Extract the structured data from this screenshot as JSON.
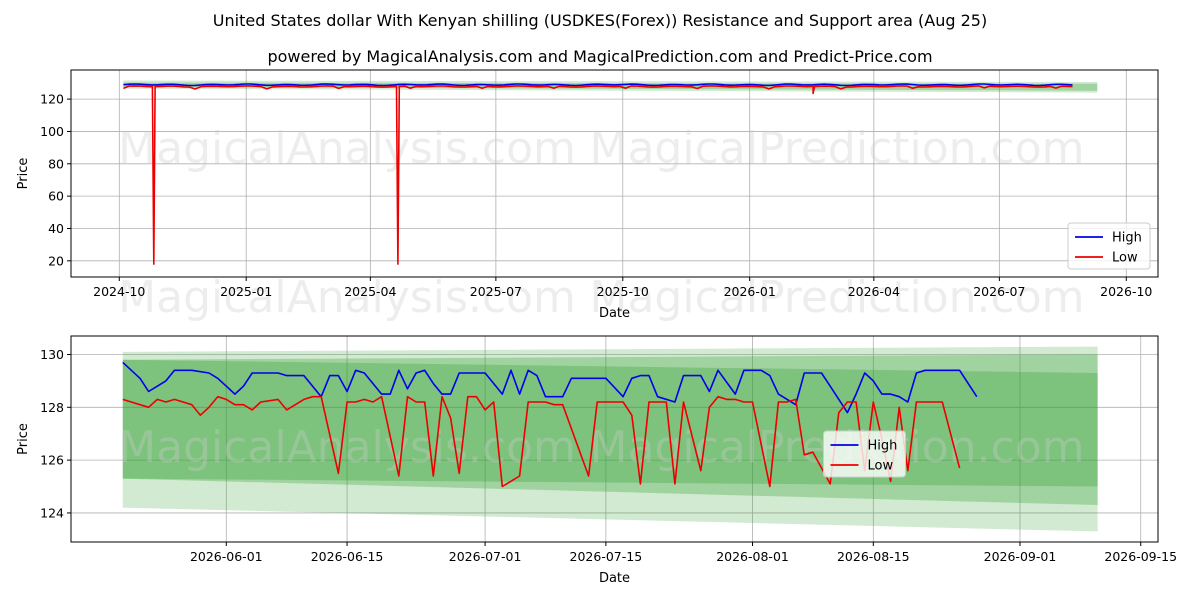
{
  "title": "United States dollar With Kenyan shilling (USDKES(Forex)) Resistance and Support area (Aug 25)",
  "subtitle": "powered by MagicalAnalysis.com and MagicalPrediction.com and Predict-Price.com",
  "watermarks": [
    "MagicalAnalysis.com",
    "MagicalPrediction.com"
  ],
  "colors": {
    "high": "#0000ee",
    "low": "#ee0000",
    "band": "#2e9e2e"
  },
  "chart_data": [
    {
      "type": "line",
      "xlabel": "Date",
      "ylabel": "Price",
      "xlim": [
        "2024-08-27",
        "2026-10-24"
      ],
      "ylim": [
        10,
        138
      ],
      "x_ticks": [
        "2024-10",
        "2025-01",
        "2025-04",
        "2025-07",
        "2025-10",
        "2026-01",
        "2026-04",
        "2026-07",
        "2026-10"
      ],
      "y_ticks": [
        20,
        40,
        60,
        80,
        100,
        120
      ],
      "grid": true,
      "legend": "lower-right",
      "series_start": "2024-10-04",
      "series_end": "2026-08-25",
      "series_defaults": {
        "high": 128.9,
        "low": 127.8
      },
      "low_spikes": [
        {
          "x": "2024-10-26",
          "low": 18
        },
        {
          "x": "2025-04-21",
          "low": 18
        },
        {
          "x": "2026-02-16",
          "low": 123.5
        }
      ],
      "bands": [
        {
          "x": [
            "2024-10-04",
            "2026-09-10"
          ],
          "upper": [
            131.5,
            130.6
          ],
          "lower": [
            126.5,
            124.0
          ]
        },
        {
          "x": [
            "2024-10-04",
            "2026-09-10"
          ],
          "upper": [
            130.2,
            129.5
          ],
          "lower": [
            127.6,
            125.2
          ]
        }
      ],
      "series": [
        {
          "name": "High",
          "color": "#0000ee"
        },
        {
          "name": "Low",
          "color": "#ee0000"
        }
      ]
    },
    {
      "type": "line",
      "xlabel": "Date",
      "ylabel": "Price",
      "xlim": [
        "2026-05-14",
        "2026-09-17"
      ],
      "ylim": [
        122.9,
        130.7
      ],
      "x_ticks": [
        "2026-06-01",
        "2026-06-15",
        "2026-07-01",
        "2026-07-15",
        "2026-08-01",
        "2026-08-15",
        "2026-09-01",
        "2026-09-15"
      ],
      "y_ticks": [
        124,
        126,
        128,
        130
      ],
      "grid": true,
      "legend": "center",
      "bands": [
        {
          "x": [
            "2026-05-20",
            "2026-09-10"
          ],
          "upper": [
            130.1,
            130.3
          ],
          "lower": [
            124.2,
            123.3
          ]
        },
        {
          "x": [
            "2026-05-20",
            "2026-09-10"
          ],
          "upper": [
            129.8,
            130.0
          ],
          "lower": [
            125.3,
            124.3
          ]
        },
        {
          "x": [
            "2026-05-20",
            "2026-09-10"
          ],
          "upper": [
            129.8,
            129.3
          ],
          "lower": [
            125.3,
            125.0
          ]
        }
      ],
      "series": [
        {
          "name": "High",
          "color": "#0000ee",
          "points": [
            [
              "2026-05-20",
              129.7
            ],
            [
              "2026-05-22",
              129.1
            ],
            [
              "2026-05-23",
              128.6
            ],
            [
              "2026-05-24",
              128.8
            ],
            [
              "2026-05-25",
              129.0
            ],
            [
              "2026-05-26",
              129.4
            ],
            [
              "2026-05-28",
              129.4
            ],
            [
              "2026-05-30",
              129.3
            ],
            [
              "2026-05-31",
              129.1
            ],
            [
              "2026-06-01",
              128.8
            ],
            [
              "2026-06-02",
              128.5
            ],
            [
              "2026-06-03",
              128.8
            ],
            [
              "2026-06-04",
              129.3
            ],
            [
              "2026-06-07",
              129.3
            ],
            [
              "2026-06-08",
              129.2
            ],
            [
              "2026-06-09",
              129.2
            ],
            [
              "2026-06-10",
              129.2
            ],
            [
              "2026-06-12",
              128.4
            ],
            [
              "2026-06-13",
              129.2
            ],
            [
              "2026-06-14",
              129.2
            ],
            [
              "2026-06-15",
              128.6
            ],
            [
              "2026-06-16",
              129.4
            ],
            [
              "2026-06-17",
              129.3
            ],
            [
              "2026-06-18",
              128.9
            ],
            [
              "2026-06-19",
              128.5
            ],
            [
              "2026-06-20",
              128.5
            ],
            [
              "2026-06-21",
              129.4
            ],
            [
              "2026-06-22",
              128.7
            ],
            [
              "2026-06-23",
              129.3
            ],
            [
              "2026-06-24",
              129.4
            ],
            [
              "2026-06-25",
              128.9
            ],
            [
              "2026-06-26",
              128.5
            ],
            [
              "2026-06-27",
              128.5
            ],
            [
              "2026-06-28",
              129.3
            ],
            [
              "2026-06-29",
              129.3
            ],
            [
              "2026-06-30",
              129.3
            ],
            [
              "2026-07-01",
              129.3
            ],
            [
              "2026-07-02",
              128.9
            ],
            [
              "2026-07-03",
              128.5
            ],
            [
              "2026-07-04",
              129.4
            ],
            [
              "2026-07-05",
              128.5
            ],
            [
              "2026-07-06",
              129.4
            ],
            [
              "2026-07-07",
              129.2
            ],
            [
              "2026-07-08",
              128.4
            ],
            [
              "2026-07-10",
              128.4
            ],
            [
              "2026-07-11",
              129.1
            ],
            [
              "2026-07-13",
              129.1
            ],
            [
              "2026-07-14",
              129.1
            ],
            [
              "2026-07-15",
              129.1
            ],
            [
              "2026-07-17",
              128.4
            ],
            [
              "2026-07-18",
              129.1
            ],
            [
              "2026-07-19",
              129.2
            ],
            [
              "2026-07-20",
              129.2
            ],
            [
              "2026-07-21",
              128.4
            ],
            [
              "2026-07-23",
              128.2
            ],
            [
              "2026-07-24",
              129.2
            ],
            [
              "2026-07-25",
              129.2
            ],
            [
              "2026-07-26",
              129.2
            ],
            [
              "2026-07-27",
              128.6
            ],
            [
              "2026-07-28",
              129.4
            ],
            [
              "2026-07-30",
              128.5
            ],
            [
              "2026-07-31",
              129.4
            ],
            [
              "2026-08-01",
              129.4
            ],
            [
              "2026-08-02",
              129.4
            ],
            [
              "2026-08-03",
              129.2
            ],
            [
              "2026-08-04",
              128.5
            ],
            [
              "2026-08-06",
              128.1
            ],
            [
              "2026-08-07",
              129.3
            ],
            [
              "2026-08-08",
              129.3
            ],
            [
              "2026-08-09",
              129.3
            ],
            [
              "2026-08-10",
              128.8
            ],
            [
              "2026-08-12",
              127.8
            ],
            [
              "2026-08-13",
              128.5
            ],
            [
              "2026-08-14",
              129.3
            ],
            [
              "2026-08-15",
              129.0
            ],
            [
              "2026-08-16",
              128.5
            ],
            [
              "2026-08-17",
              128.5
            ],
            [
              "2026-08-18",
              128.4
            ],
            [
              "2026-08-19",
              128.2
            ],
            [
              "2026-08-20",
              129.3
            ],
            [
              "2026-08-21",
              129.4
            ],
            [
              "2026-08-22",
              129.4
            ],
            [
              "2026-08-23",
              129.4
            ],
            [
              "2026-08-25",
              129.4
            ],
            [
              "2026-08-27",
              128.4
            ]
          ]
        },
        {
          "name": "Low",
          "color": "#ee0000",
          "points": [
            [
              "2026-05-20",
              128.3
            ],
            [
              "2026-05-22",
              128.1
            ],
            [
              "2026-05-23",
              128.0
            ],
            [
              "2026-05-24",
              128.3
            ],
            [
              "2026-05-25",
              128.2
            ],
            [
              "2026-05-26",
              128.3
            ],
            [
              "2026-05-28",
              128.1
            ],
            [
              "2026-05-29",
              127.7
            ],
            [
              "2026-05-30",
              128.0
            ],
            [
              "2026-05-31",
              128.4
            ],
            [
              "2026-06-01",
              128.3
            ],
            [
              "2026-06-02",
              128.1
            ],
            [
              "2026-06-03",
              128.1
            ],
            [
              "2026-06-04",
              127.9
            ],
            [
              "2026-06-05",
              128.2
            ],
            [
              "2026-06-07",
              128.3
            ],
            [
              "2026-06-08",
              127.9
            ],
            [
              "2026-06-09",
              128.1
            ],
            [
              "2026-06-10",
              128.3
            ],
            [
              "2026-06-11",
              128.4
            ],
            [
              "2026-06-12",
              128.4
            ],
            [
              "2026-06-14",
              125.5
            ],
            [
              "2026-06-15",
              128.2
            ],
            [
              "2026-06-16",
              128.2
            ],
            [
              "2026-06-17",
              128.3
            ],
            [
              "2026-06-18",
              128.2
            ],
            [
              "2026-06-19",
              128.4
            ],
            [
              "2026-06-21",
              125.4
            ],
            [
              "2026-06-22",
              128.4
            ],
            [
              "2026-06-23",
              128.2
            ],
            [
              "2026-06-24",
              128.2
            ],
            [
              "2026-06-25",
              125.4
            ],
            [
              "2026-06-26",
              128.4
            ],
            [
              "2026-06-27",
              127.6
            ],
            [
              "2026-06-28",
              125.5
            ],
            [
              "2026-06-29",
              128.4
            ],
            [
              "2026-06-30",
              128.4
            ],
            [
              "2026-07-01",
              127.9
            ],
            [
              "2026-07-02",
              128.2
            ],
            [
              "2026-07-03",
              125.0
            ],
            [
              "2026-07-05",
              125.4
            ],
            [
              "2026-07-06",
              128.2
            ],
            [
              "2026-07-08",
              128.2
            ],
            [
              "2026-07-09",
              128.1
            ],
            [
              "2026-07-10",
              128.1
            ],
            [
              "2026-07-13",
              125.4
            ],
            [
              "2026-07-14",
              128.2
            ],
            [
              "2026-07-15",
              128.2
            ],
            [
              "2026-07-16",
              128.2
            ],
            [
              "2026-07-17",
              128.2
            ],
            [
              "2026-07-18",
              127.7
            ],
            [
              "2026-07-19",
              125.1
            ],
            [
              "2026-07-20",
              128.2
            ],
            [
              "2026-07-21",
              128.2
            ],
            [
              "2026-07-22",
              128.2
            ],
            [
              "2026-07-23",
              125.1
            ],
            [
              "2026-07-24",
              128.2
            ],
            [
              "2026-07-26",
              125.6
            ],
            [
              "2026-07-27",
              128.0
            ],
            [
              "2026-07-28",
              128.4
            ],
            [
              "2026-07-29",
              128.3
            ],
            [
              "2026-07-30",
              128.3
            ],
            [
              "2026-07-31",
              128.2
            ],
            [
              "2026-08-01",
              128.2
            ],
            [
              "2026-08-03",
              125.0
            ],
            [
              "2026-08-04",
              128.2
            ],
            [
              "2026-08-05",
              128.2
            ],
            [
              "2026-08-06",
              128.3
            ],
            [
              "2026-08-07",
              126.2
            ],
            [
              "2026-08-08",
              126.3
            ],
            [
              "2026-08-10",
              125.1
            ],
            [
              "2026-08-11",
              127.8
            ],
            [
              "2026-08-12",
              128.2
            ],
            [
              "2026-08-13",
              128.2
            ],
            [
              "2026-08-14",
              125.6
            ],
            [
              "2026-08-15",
              128.2
            ],
            [
              "2026-08-16",
              126.8
            ],
            [
              "2026-08-17",
              125.2
            ],
            [
              "2026-08-18",
              128.0
            ],
            [
              "2026-08-19",
              125.6
            ],
            [
              "2026-08-20",
              128.2
            ],
            [
              "2026-08-22",
              128.2
            ],
            [
              "2026-08-23",
              128.2
            ],
            [
              "2026-08-25",
              125.7
            ]
          ]
        }
      ]
    }
  ]
}
